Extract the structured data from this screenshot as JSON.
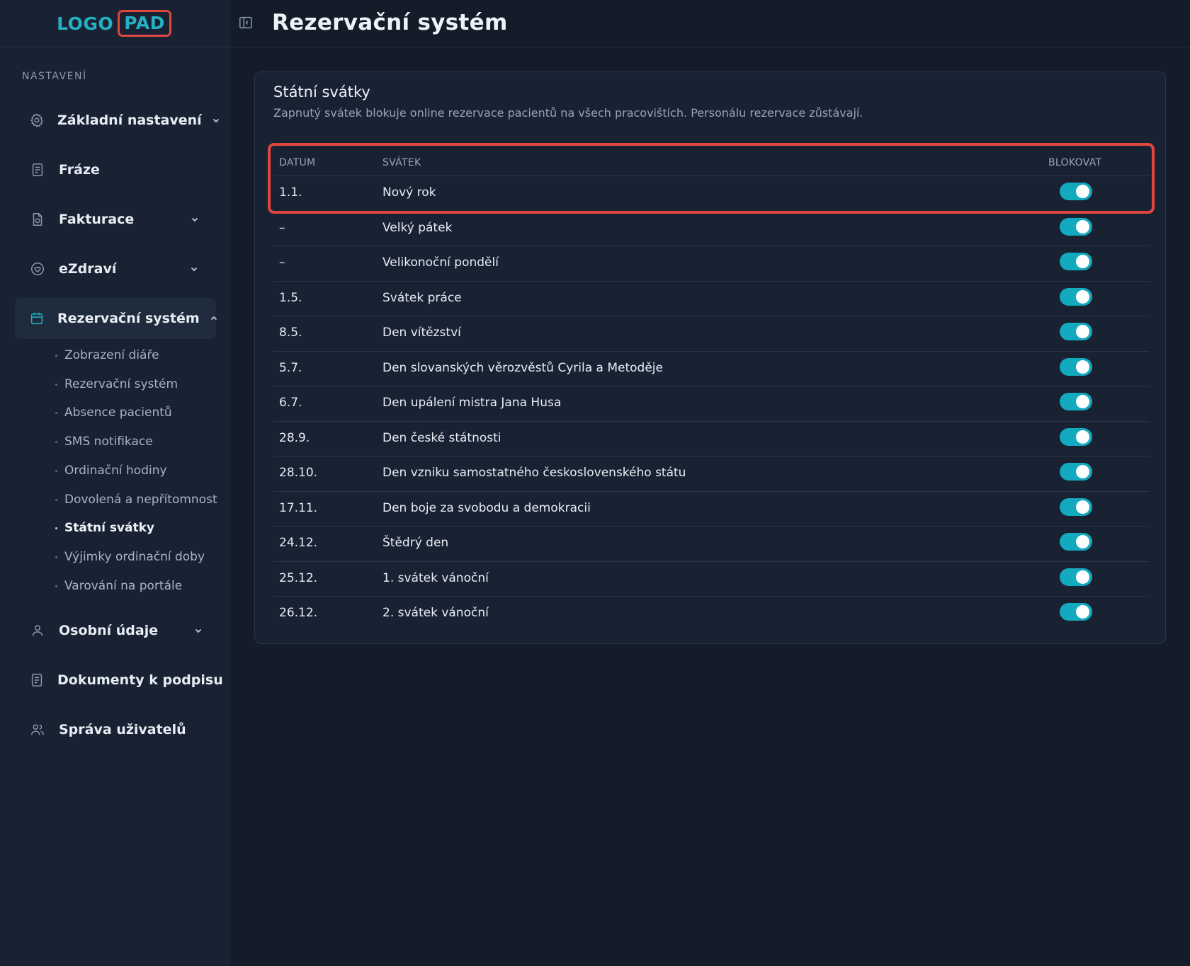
{
  "logo": {
    "part1": "LOGO",
    "part2": "PAD"
  },
  "sidebar": {
    "section_label": "NASTAVENÍ",
    "items": [
      {
        "label": "Základní nastavení",
        "icon": "gear-icon",
        "has_chevron": true
      },
      {
        "label": "Fráze",
        "icon": "document-icon",
        "has_chevron": false
      },
      {
        "label": "Fakturace",
        "icon": "invoice-icon",
        "has_chevron": true
      },
      {
        "label": "eZdraví",
        "icon": "heart-icon",
        "has_chevron": true
      },
      {
        "label": "Rezervační systém",
        "icon": "calendar-icon",
        "has_chevron": true,
        "expanded": true
      },
      {
        "label": "Osobní údaje",
        "icon": "user-icon",
        "has_chevron": true
      },
      {
        "label": "Dokumenty k podpisu",
        "icon": "document-icon",
        "has_chevron": false
      },
      {
        "label": "Správa uživatelů",
        "icon": "users-icon",
        "has_chevron": false
      }
    ],
    "sub_items": [
      "Zobrazení diáře",
      "Rezervační systém",
      "Absence pacientů",
      "SMS notifikace",
      "Ordinační hodiny",
      "Dovolená a nepřítomnost",
      "Státní svátky",
      "Výjimky ordinační doby",
      "Varování na portále"
    ],
    "active_sub_item": "Státní svátky"
  },
  "header": {
    "title": "Rezervační systém"
  },
  "card": {
    "title": "Státní svátky",
    "description": "Zapnutý svátek blokuje online rezervace pacientů na všech pracovištích. Personálu rezervace zůstávají.",
    "columns": [
      "DATUM",
      "SVÁTEK",
      "BLOKOVAT"
    ],
    "rows": [
      {
        "date": "1.1.",
        "name": "Nový rok",
        "blocked": true
      },
      {
        "date": "–",
        "name": "Velký pátek",
        "blocked": true
      },
      {
        "date": "–",
        "name": "Velikonoční pondělí",
        "blocked": true
      },
      {
        "date": "1.5.",
        "name": "Svátek práce",
        "blocked": true
      },
      {
        "date": "8.5.",
        "name": "Den vítězství",
        "blocked": true
      },
      {
        "date": "5.7.",
        "name": "Den slovanských věrozvěstů Cyrila a Metoděje",
        "blocked": true
      },
      {
        "date": "6.7.",
        "name": "Den upálení mistra Jana Husa",
        "blocked": true
      },
      {
        "date": "28.9.",
        "name": "Den české státnosti",
        "blocked": true
      },
      {
        "date": "28.10.",
        "name": "Den vzniku samostatného československého státu",
        "blocked": true
      },
      {
        "date": "17.11.",
        "name": "Den boje za svobodu a demokracii",
        "blocked": true
      },
      {
        "date": "24.12.",
        "name": "Štědrý den",
        "blocked": true
      },
      {
        "date": "25.12.",
        "name": "1. svátek vánoční",
        "blocked": true
      },
      {
        "date": "26.12.",
        "name": "2. svátek vánoční",
        "blocked": true
      }
    ]
  },
  "colors": {
    "accent": "#13a9be",
    "highlight": "#e0463e",
    "background": "#141c2a",
    "sidebar": "#182233"
  }
}
